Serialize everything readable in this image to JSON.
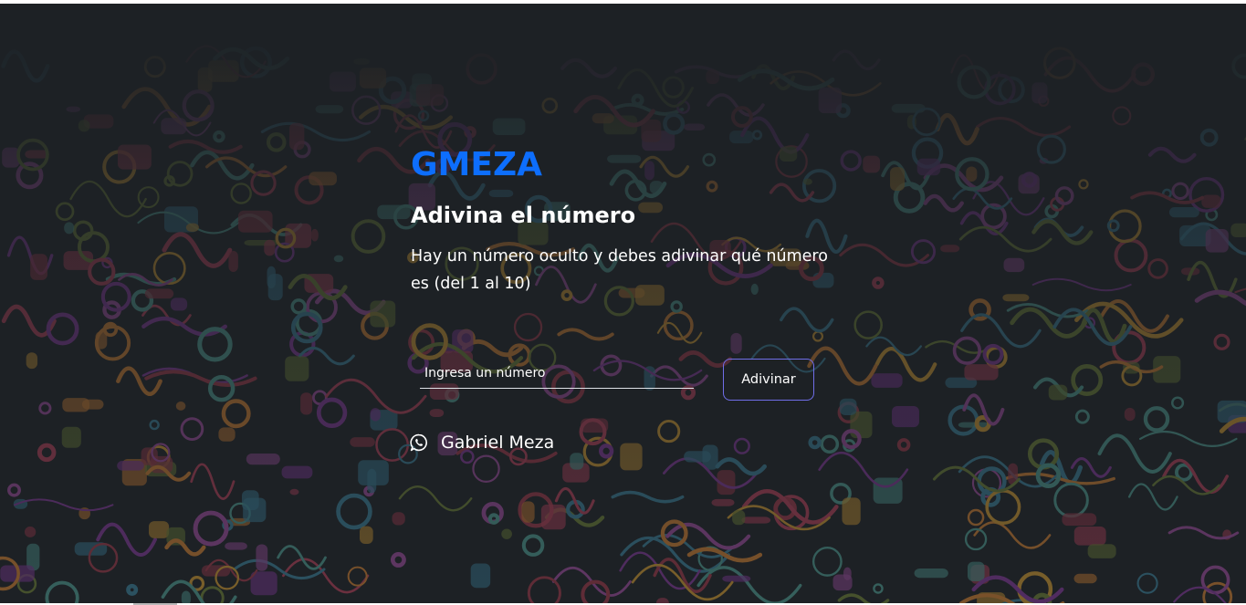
{
  "brand": {
    "title": "GMEZA",
    "color": "#0d6efd"
  },
  "game": {
    "heading": "Adivina el número",
    "description": "Hay un número oculto y debes adivinar qué número es (del 1 al 10)"
  },
  "form": {
    "input_placeholder": "Ingresa un número",
    "input_value": "",
    "button_label": "Adivinar",
    "button_border_color": "#6f6ee8"
  },
  "footer": {
    "author_name": "Gabriel Meza",
    "icon": "whatsapp-icon"
  },
  "background": {
    "base_color": "#1d2125",
    "pattern": "colorful doodle art"
  }
}
